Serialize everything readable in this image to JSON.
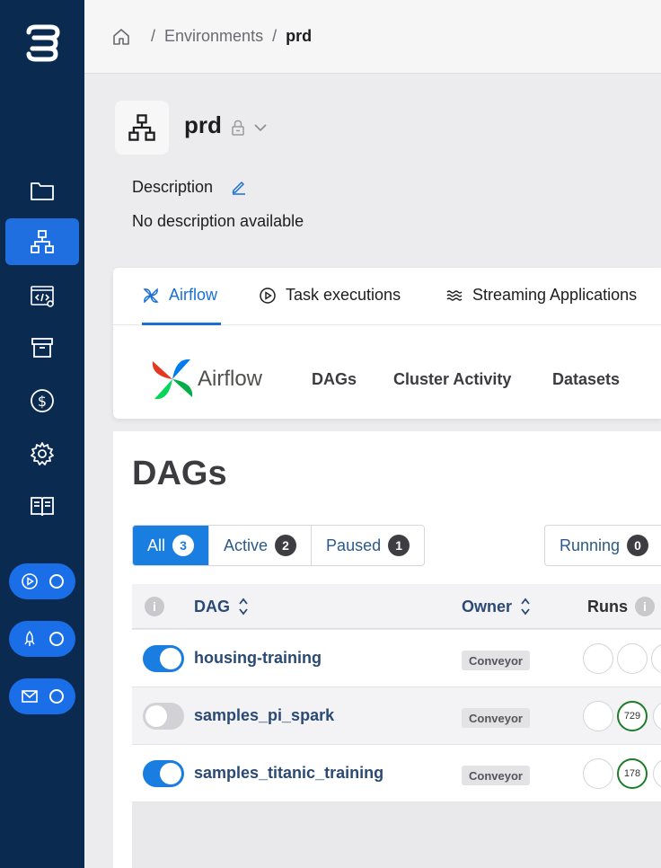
{
  "breadcrumb": {
    "home_icon": "home-icon",
    "items": [
      "Environments"
    ],
    "separator": "/",
    "current": "prd"
  },
  "sidebar": {
    "icons": [
      "folder-icon",
      "environment-icon",
      "code-icon",
      "archive-icon",
      "billing-icon",
      "settings-icon",
      "docs-icon"
    ],
    "active_index": 1,
    "pills": [
      "play-status-icon",
      "deploy-status-icon",
      "mail-status-icon"
    ]
  },
  "environment": {
    "name": "prd",
    "description_label": "Description",
    "description": "No description available"
  },
  "tabs": [
    {
      "label": "Airflow",
      "icon": "airflow-icon",
      "active": true
    },
    {
      "label": "Task executions",
      "icon": "play-circle-icon",
      "active": false
    },
    {
      "label": "Streaming Applications",
      "icon": "waves-icon",
      "active": false
    }
  ],
  "airflow_nav": {
    "brand": "Airflow",
    "links": [
      "DAGs",
      "Cluster Activity",
      "Datasets"
    ]
  },
  "dags_page": {
    "title": "DAGs",
    "filters": [
      {
        "label": "All",
        "count": "3",
        "active": true
      },
      {
        "label": "Active",
        "count": "2",
        "active": false
      },
      {
        "label": "Paused",
        "count": "1",
        "active": false
      }
    ],
    "running": {
      "label": "Running",
      "count": "0"
    },
    "columns": {
      "info": "i",
      "dag": "DAG",
      "owner": "Owner",
      "runs": "Runs"
    },
    "rows": [
      {
        "name": "housing-training",
        "enabled": true,
        "owner": "Conveyor",
        "runs": [
          "",
          ""
        ]
      },
      {
        "name": "samples_pi_spark",
        "enabled": false,
        "owner": "Conveyor",
        "runs": [
          "",
          "729"
        ]
      },
      {
        "name": "samples_titanic_training",
        "enabled": true,
        "owner": "Conveyor",
        "runs": [
          "",
          "178"
        ]
      }
    ]
  },
  "colors": {
    "sidebar": "#0a2a4f",
    "accent": "#1a7de0",
    "success": "#1e7b28"
  }
}
